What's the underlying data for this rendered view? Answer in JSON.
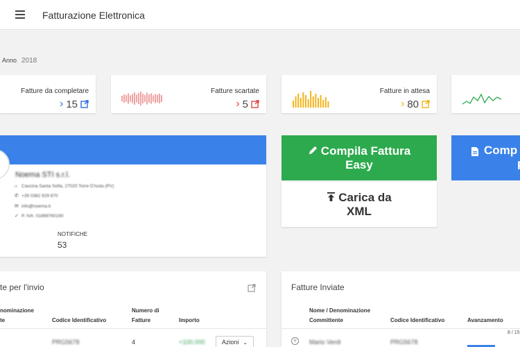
{
  "header": {
    "title": "Fatturazione Elettronica"
  },
  "filters": {
    "year_label": "Anno",
    "year_value": "2018"
  },
  "stats": [
    {
      "title": "Fatture da completare",
      "count": "15",
      "color": "#2f6fdf"
    },
    {
      "title": "Fatture scartate",
      "count": "5",
      "color": "#e04545"
    },
    {
      "title": "Fatture in attesa",
      "count": "80",
      "color": "#f2b418"
    },
    {
      "title": "",
      "count": "",
      "color": "#2daa4e"
    }
  ],
  "profile": {
    "company": "Noema STI s.r.l.",
    "address": "Cascina Santa Sofia, 27020 Torre D'Isola (PV)",
    "phone": "+39 0382 929 870",
    "email": "info@noema.it",
    "vat": "P. IVA: 01899760190",
    "notifications_label": "NOTIFICHE",
    "notifications_value": "53"
  },
  "actions": {
    "compile_easy": "Compila Fattura Easy",
    "upload_xml": "Carica da XML",
    "compile_full_1": "Comp",
    "compile_full_2": "F"
  },
  "ready_panel": {
    "title": "te per l'invio",
    "columns": [
      "nominazione\nte",
      "Codice Identificativo",
      "Numero di\nFatture",
      "Importo"
    ],
    "row": {
      "code": "PRG5678",
      "count": "4",
      "amount": "+100.000",
      "actions_label": "Azioni"
    }
  },
  "sent_panel": {
    "title": "Fatture Inviate",
    "columns": [
      "Nome / Denominazione\nCommittente",
      "Codice Identificativo",
      "Avanzamento"
    ],
    "row": {
      "name": "Mario Verdi",
      "code": "PRG5678",
      "progress_text": "8 / 15"
    }
  }
}
